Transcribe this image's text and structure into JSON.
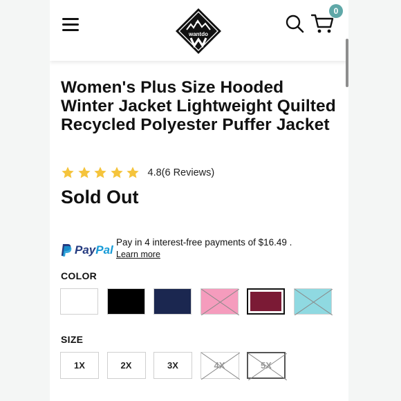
{
  "header": {
    "brand": "wantdo",
    "cart_count": "0"
  },
  "product": {
    "title": "Women's Plus Size Hooded Winter Jacket Lightweight Quilted Recycled Polyester Puffer Jacket",
    "rating_value": 4.8,
    "rating_text": "4.8(6 Reviews)",
    "stars_filled": 5,
    "stars_total": 5,
    "star_color": "#f5c43c",
    "status": "Sold Out"
  },
  "paypal": {
    "logo_pay": "Pay",
    "logo_pal": "Pal",
    "message": "Pay in 4 interest-free payments of $16.49 .",
    "link": "Learn more"
  },
  "color_section": {
    "label": "COLOR",
    "options": [
      {
        "name": "white",
        "color": "#ffffff",
        "available": true,
        "selected": false
      },
      {
        "name": "black",
        "color": "#000000",
        "available": true,
        "selected": false
      },
      {
        "name": "navy",
        "color": "#1b2750",
        "available": true,
        "selected": false
      },
      {
        "name": "pink",
        "color": "#f59cbd",
        "available": false,
        "selected": false
      },
      {
        "name": "burgundy",
        "color": "#7b1a35",
        "available": true,
        "selected": true
      },
      {
        "name": "light-blue",
        "color": "#8fd9e1",
        "available": false,
        "selected": false
      }
    ]
  },
  "size_section": {
    "label": "SIZE",
    "options": [
      {
        "label": "1X",
        "available": true,
        "selected": false
      },
      {
        "label": "2X",
        "available": true,
        "selected": false
      },
      {
        "label": "3X",
        "available": true,
        "selected": false
      },
      {
        "label": "4X",
        "available": false,
        "selected": false
      },
      {
        "label": "5X",
        "available": false,
        "selected": true
      }
    ]
  }
}
